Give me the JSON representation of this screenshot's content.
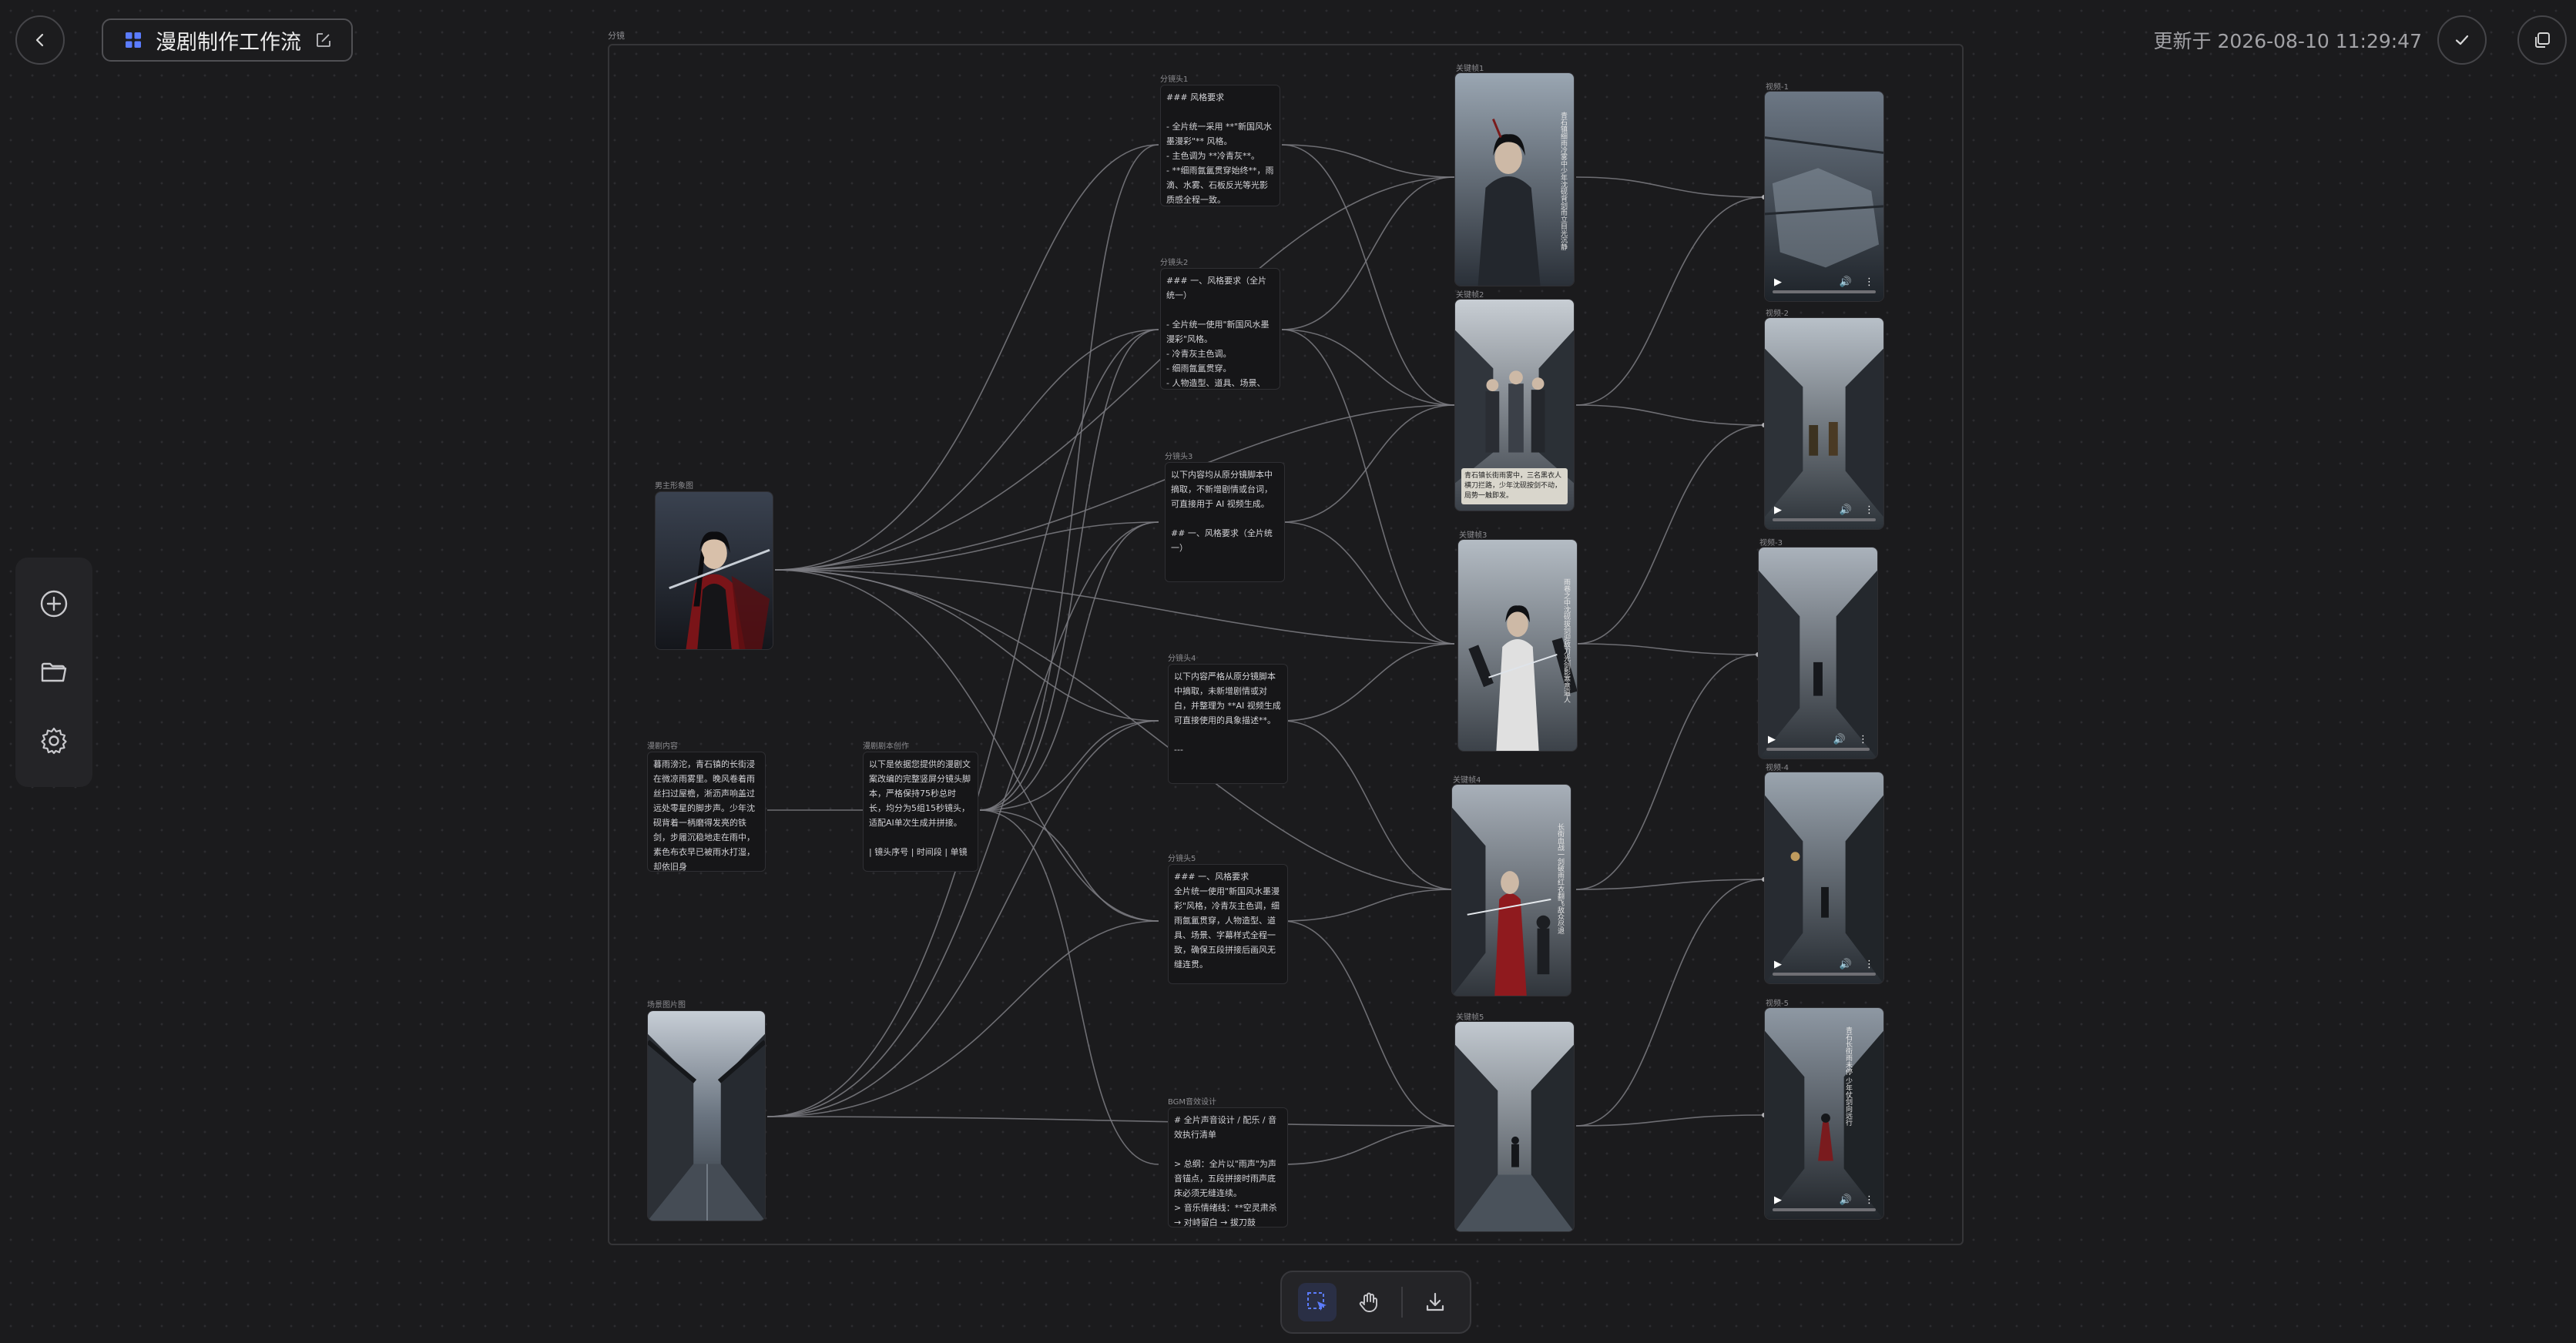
{
  "header": {
    "title": "漫剧制作工作流",
    "updated_text": "更新于 2026-08-10 11:29:47"
  },
  "canvas": {
    "group_label": "分镜",
    "nodes": {
      "hero_image": {
        "label": "男主形象图"
      },
      "drama_content": {
        "label": "漫剧内容",
        "text": "暮雨滂沱，青石镇的长街浸在微凉雨雾里。晚风卷着雨丝扫过屋檐，淅沥声响盖过远处零星的脚步声。少年沈砚背着一柄磨得发亮的铁剑，步履沉稳地走在雨中，素色布衣早已被雨水打湿，却依旧身"
      },
      "script_creation": {
        "label": "漫剧剧本创作",
        "text": "以下是依据您提供的漫剧文案改编的完整竖屏分镜头脚本，严格保持75秒总时长，均分为5组15秒镜头，适配AI单次生成并拼接。\n\n| 镜头序号 | 时间段 | 单镜"
      },
      "scene_image": {
        "label": "场景图片图"
      },
      "storyboard_1": {
        "label": "分镜头1",
        "text": "### 风格要求\n\n- 全片统一采用 **\"新国风水墨漫彩\"** 风格。\n- 主色调为 **冷青灰**。\n- **细雨氤氲贯穿始终**，雨滴、水雾、石板反光等光影质感全程一致。"
      },
      "storyboard_2": {
        "label": "分镜头2",
        "text": "### 一、风格要求（全片统一）\n\n- 全片统一使用\"新国风水墨漫彩\"风格。\n- 冷青灰主色调。\n- 细雨氤氲贯穿。\n- 人物造型、道具、场景、"
      },
      "storyboard_3": {
        "label": "分镜头3",
        "text": "以下内容均从原分镜脚本中摘取，不新增剧情或台词，可直接用于 AI 视频生成。\n\n## 一、风格要求（全片统一）"
      },
      "storyboard_4": {
        "label": "分镜头4",
        "text": "以下内容严格从原分镜脚本中摘取，未新增剧情或对白，并整理为 **AI 视频生成可直接使用的具象描述**。\n\n---"
      },
      "storyboard_5": {
        "label": "分镜头5",
        "text": "### 一、风格要求\n全片统一使用\"新国风水墨漫彩\"风格，冷青灰主色调，细雨氤氲贯穿，人物造型、道具、场景、字幕样式全程一致，确保五段拼接后画风无缝连贯。"
      },
      "bgm_design": {
        "label": "BGM音效设计",
        "text": "# 全片声音设计 / 配乐 / 音效执行清单\n\n> 总纲：全片以\"雨声\"为声音锚点，五段拼接时雨声底床必须无缝连续。\n> 音乐情绪线：**空灵肃杀 → 对峙留白 → 拔刀鼓"
      },
      "keyframes": [
        {
          "label": "关键帧1",
          "vertical_text": "青石镇细雨冷雾中少年沈砚背剑而立目光沉静"
        },
        {
          "label": "关键帧2",
          "caption": "青石镇长街雨雾中，三名黑衣人横刀拦路，少年沈砚按剑不动，局势一触即发。"
        },
        {
          "label": "关键帧3",
          "vertical_text": "雨巷之中沈砚拔剑迎敌刀光剑影寒意逼人"
        },
        {
          "label": "关键帧4",
          "vertical_text": "长街血战一剑破雨红衣翻飞敌众尽退"
        },
        {
          "label": "关键帧5"
        }
      ],
      "videos": [
        {
          "label": "视频-1"
        },
        {
          "label": "视频-2"
        },
        {
          "label": "视频-3"
        },
        {
          "label": "视频-4"
        },
        {
          "label": "视频-5",
          "vertical_text": "青石长街雨未停 少年仗剑向远行"
        }
      ]
    }
  },
  "icons": {
    "back": "chevron-left-icon",
    "workflow": "grid-icon",
    "edit": "edit-icon",
    "save": "check-icon",
    "copy": "copy-icon",
    "add": "plus-circle-icon",
    "folder": "folder-icon",
    "settings": "gear-icon",
    "select": "select-box-icon",
    "pan": "hand-icon",
    "download": "download-icon"
  },
  "colors": {
    "accent": "#5b7cff",
    "background": "#1b1b1d",
    "edge": "#8a8a8e"
  }
}
